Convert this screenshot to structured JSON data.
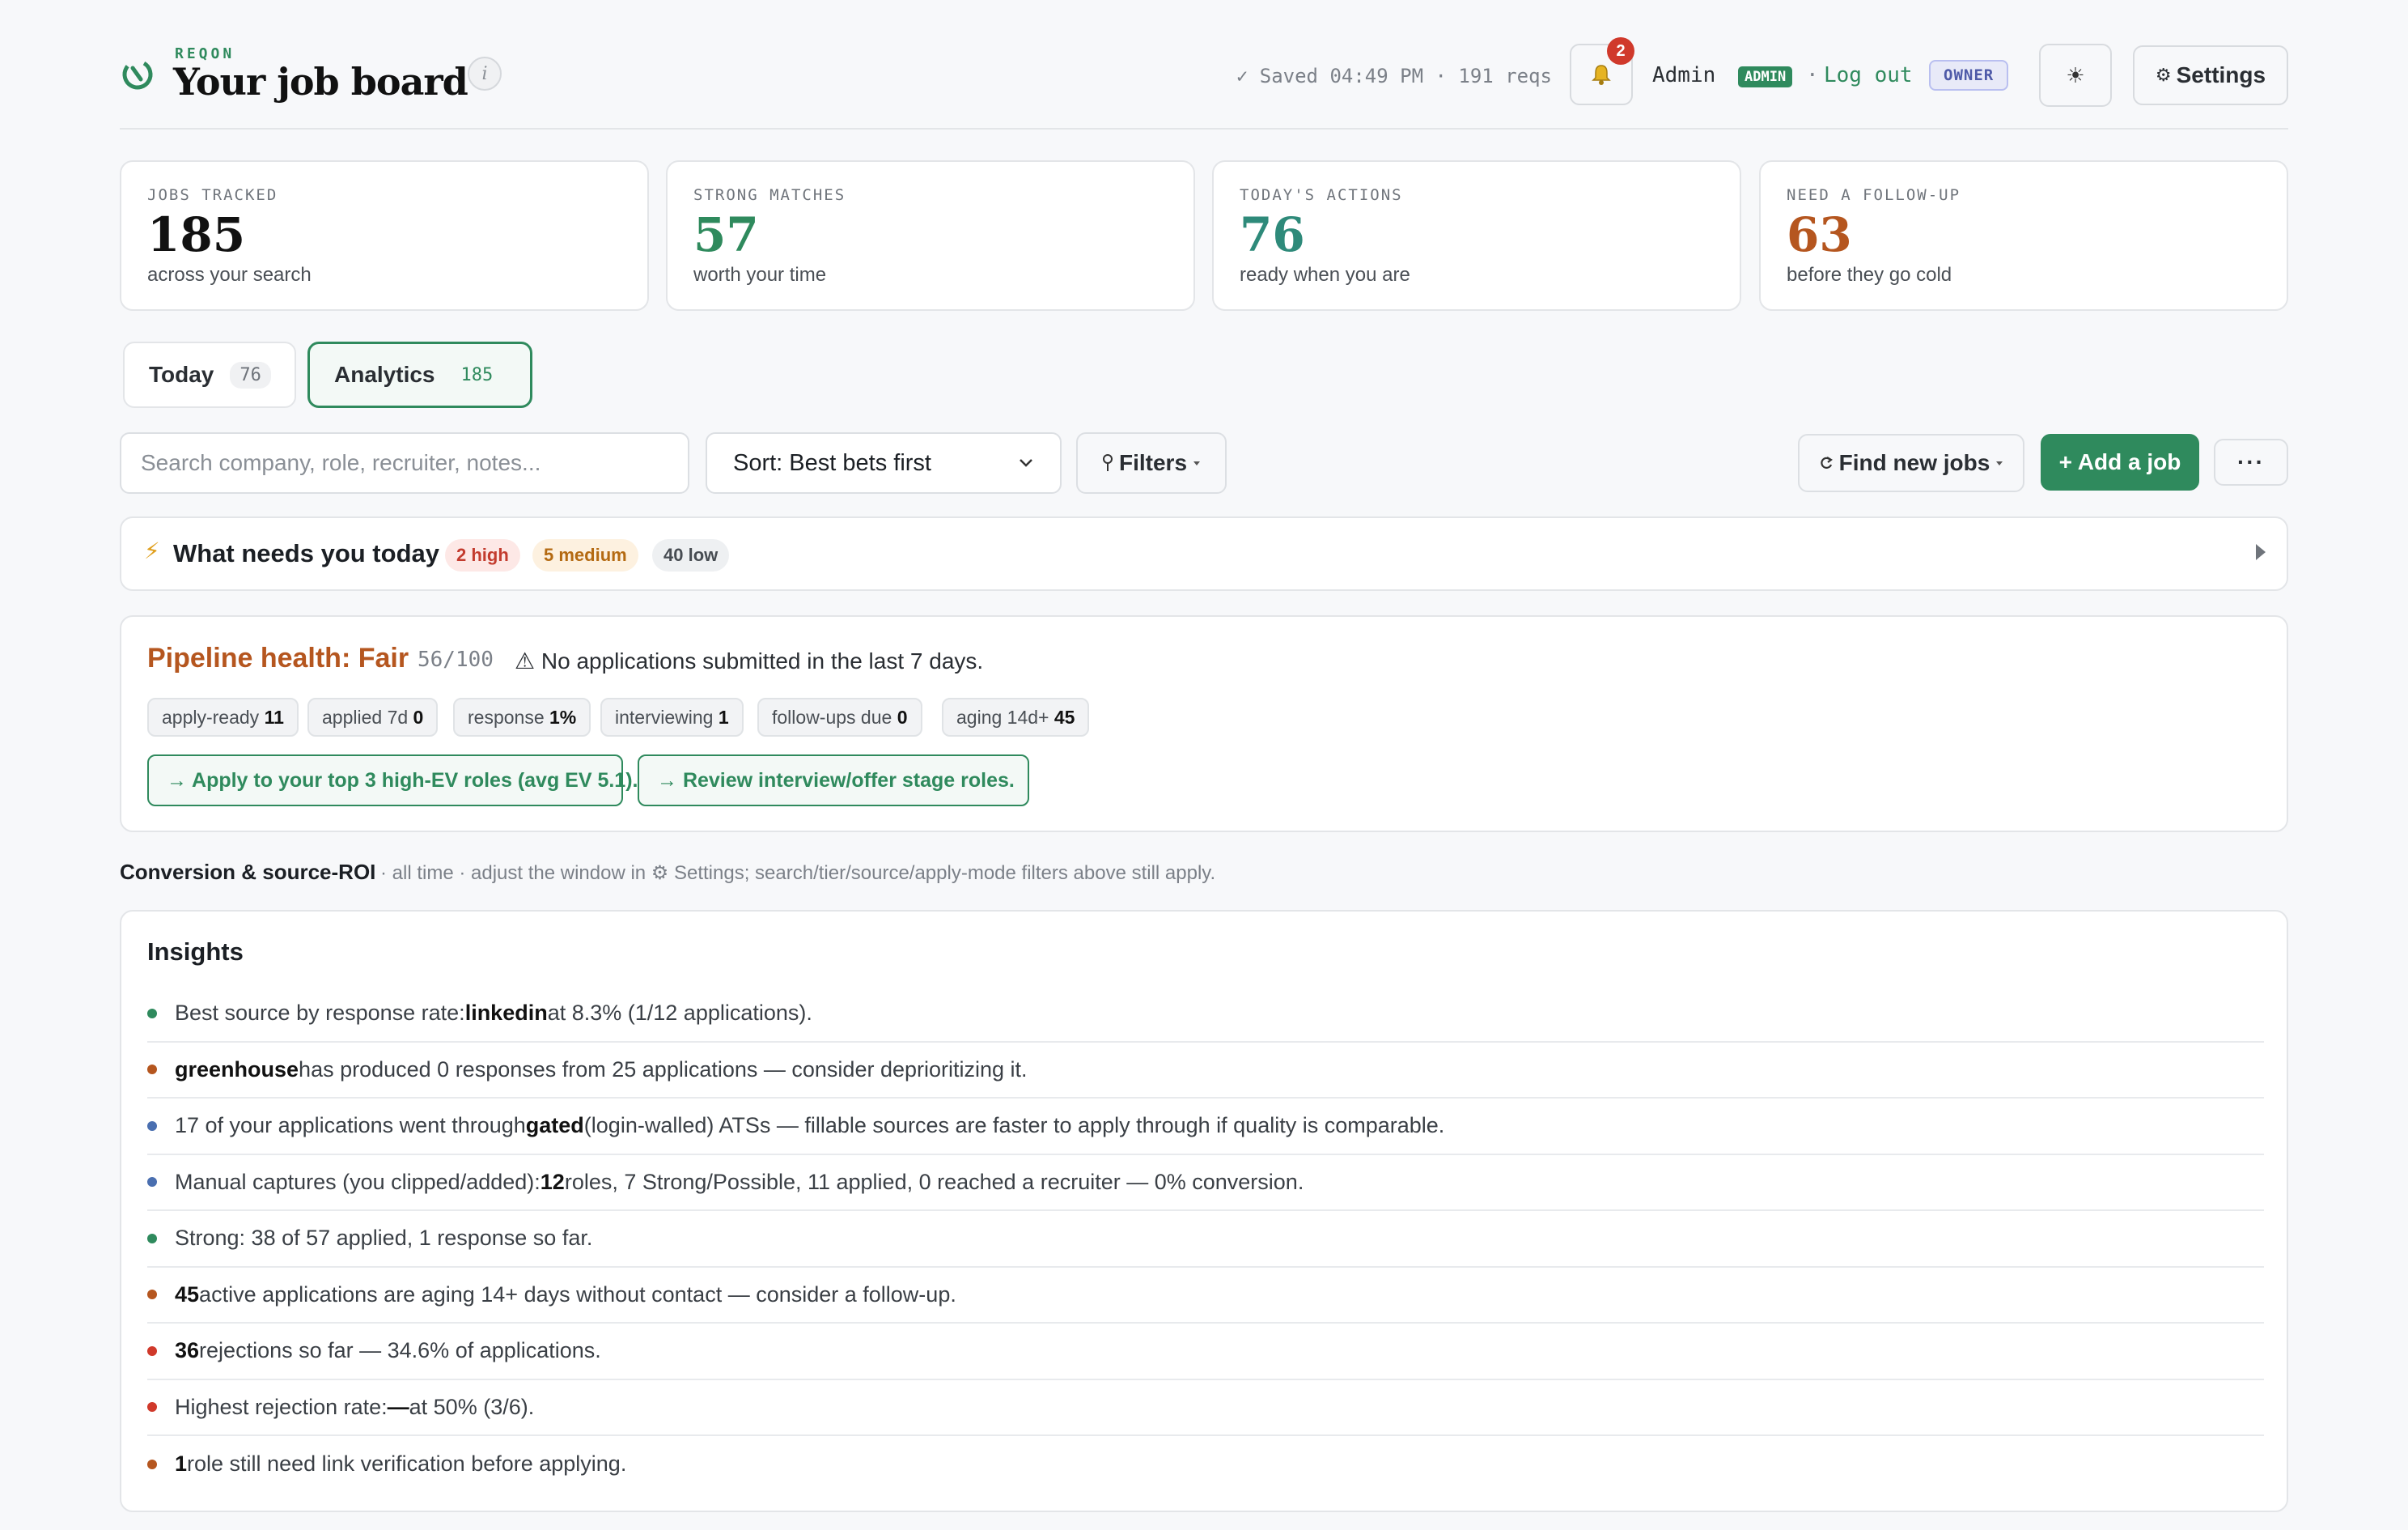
{
  "header": {
    "brand_small": "REQON",
    "title": "Your job board",
    "info": "i",
    "saved": "✓ Saved 04:49 PM · 191 reqs",
    "notifications": "2",
    "user": "Admin",
    "admin_badge": "ADMIN",
    "separator": "·",
    "logout": "Log out",
    "owner_badge": "OWNER",
    "theme_icon": "☀",
    "settings_icon": "⚙",
    "settings": "Settings"
  },
  "stats": [
    {
      "label": "JOBS TRACKED",
      "value": "185",
      "sub": "across your search",
      "color": "#111111"
    },
    {
      "label": "STRONG MATCHES",
      "value": "57",
      "sub": "worth your time",
      "color": "#2f8a5d"
    },
    {
      "label": "TODAY'S ACTIONS",
      "value": "76",
      "sub": "ready when you are",
      "color": "#2e8a7a"
    },
    {
      "label": "NEED A FOLLOW-UP",
      "value": "63",
      "sub": "before they go cold",
      "color": "#b5561f"
    }
  ],
  "tabs": [
    {
      "label": "Today",
      "count": "76"
    },
    {
      "label": "Analytics",
      "count": "185"
    }
  ],
  "toolbar": {
    "search_placeholder": "Search company, role, recruiter, notes...",
    "sort": "Sort: Best bets first",
    "filters": "Filters",
    "find": "Find new jobs",
    "add": "+ Add a job",
    "more": "···"
  },
  "needs": {
    "icon": "⚡",
    "title": "What needs you today",
    "high": "2 high",
    "medium": "5 medium",
    "low": "40 low"
  },
  "pipeline": {
    "title": "Pipeline health: Fair",
    "score": "56/100",
    "warning": "⚠ No applications submitted in the last 7 days.",
    "chips": [
      {
        "label": "apply-ready",
        "value": "11"
      },
      {
        "label": "applied 7d",
        "value": "0"
      },
      {
        "label": "response",
        "value": "1%"
      },
      {
        "label": "interviewing",
        "value": "1"
      },
      {
        "label": "follow-ups due",
        "value": "0"
      },
      {
        "label": "aging 14d+",
        "value": "45"
      }
    ],
    "actions": [
      "→ Apply to your top 3 high-EV roles (avg EV 5.1).",
      "→ Review interview/offer stage roles."
    ]
  },
  "conversion": {
    "title": "Conversion & source-ROI",
    "subtitle": "· all time · adjust the window in ⚙ Settings; search/tier/source/apply-mode filters above still apply."
  },
  "insights": {
    "title": "Insights",
    "items": [
      {
        "color": "#2f8a5d",
        "pre": "Best source by response rate: ",
        "bold": "linkedin",
        "post": " at 8.3% (1/12 applications)."
      },
      {
        "color": "#b5561f",
        "pre": "",
        "bold": "greenhouse",
        "post": " has produced 0 responses from 25 applications — consider deprioritizing it."
      },
      {
        "color": "#4a6fb0",
        "pre": "17 of your applications went through ",
        "bold": "gated",
        "post": " (login-walled) ATSs — fillable sources are faster to apply through if quality is comparable."
      },
      {
        "color": "#4a6fb0",
        "pre": "Manual captures (you clipped/added): ",
        "bold": "12",
        "post": " roles, 7 Strong/Possible, 11 applied, 0 reached a recruiter — 0% conversion."
      },
      {
        "color": "#2f8a5d",
        "pre": "Strong: 38 of 57 applied, 1 response so far.",
        "bold": "",
        "post": ""
      },
      {
        "color": "#b5561f",
        "pre": "",
        "bold": "45",
        "post": " active applications are aging 14+ days without contact — consider a follow-up."
      },
      {
        "color": "#d0392b",
        "pre": "",
        "bold": "36",
        "post": " rejections so far — 34.6% of applications."
      },
      {
        "color": "#d0392b",
        "pre": "Highest rejection rate: ",
        "bold": "—",
        "post": " at 50% (3/6)."
      },
      {
        "color": "#b5561f",
        "pre": "",
        "bold": "1",
        "post": " role still need link verification before applying."
      }
    ]
  }
}
